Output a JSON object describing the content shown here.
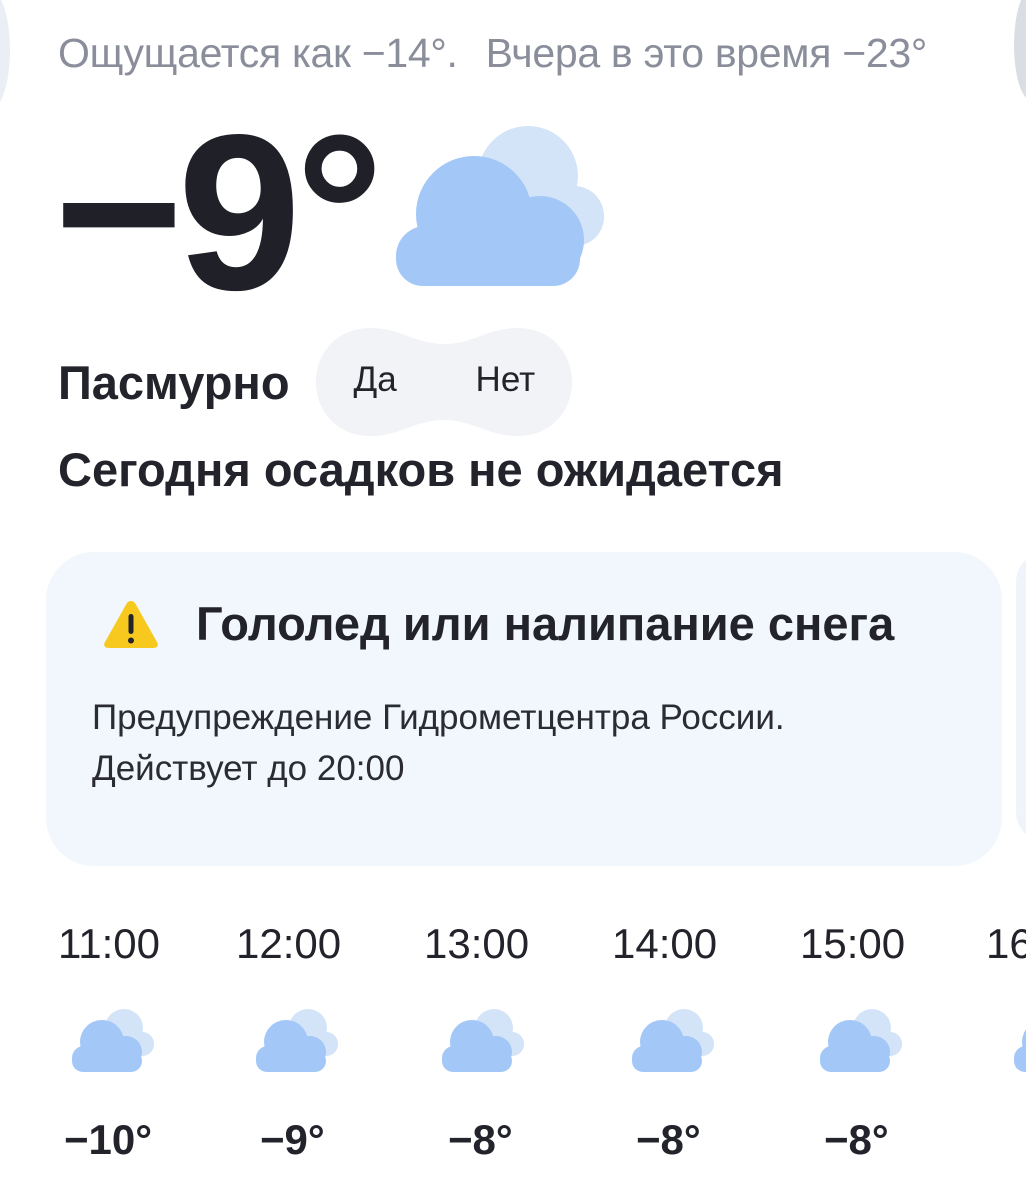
{
  "header": {
    "feels_like": "Ощущается как −14°.",
    "yesterday": "Вчера в это время −23°"
  },
  "current": {
    "temperature": "−9°",
    "condition": "Пасмурно",
    "condition_icon": "overcast-cloud-icon",
    "precipitation": "Сегодня осадков не ожидается"
  },
  "poll": {
    "yes": "Да",
    "no": "Нет"
  },
  "alert": {
    "icon": "warning-icon",
    "title": "Гололед или налипание снега",
    "line1": "Предупреждение Гидрометцентра России.",
    "line2": "Действует до 20:00"
  },
  "hourly": [
    {
      "time": "11:00",
      "temp": "−10°",
      "icon": "overcast-cloud-icon"
    },
    {
      "time": "12:00",
      "temp": "−9°",
      "icon": "overcast-cloud-icon"
    },
    {
      "time": "13:00",
      "temp": "−8°",
      "icon": "overcast-cloud-icon"
    },
    {
      "time": "14:00",
      "temp": "−8°",
      "icon": "overcast-cloud-icon"
    },
    {
      "time": "15:00",
      "temp": "−8°",
      "icon": "overcast-cloud-icon"
    },
    {
      "time": "16",
      "temp": "",
      "icon": "overcast-cloud-icon"
    }
  ],
  "colors": {
    "cloud_front": "#a3c7f7",
    "cloud_back": "#d4e4f8",
    "alert_bg": "#f1f7fc",
    "warning_yellow": "#f7c91f"
  }
}
